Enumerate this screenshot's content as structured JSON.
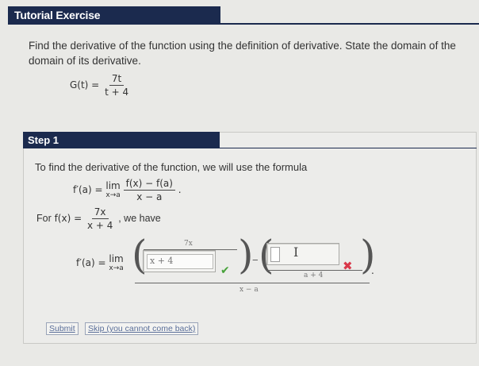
{
  "tutorial": {
    "title": "Tutorial Exercise"
  },
  "problem": {
    "text": "Find the derivative of the function using the definition of derivative. State the domain of the domain of its derivative.",
    "function_lhs": "G(t) =",
    "function_num": "7t",
    "function_den": "t + 4"
  },
  "step": {
    "title": "Step 1",
    "intro": "To find the derivative of the function, we will use the formula",
    "formula_lhs": "f′(a) =",
    "lim_word": "lim",
    "lim_sub": "x→a",
    "formula_num": "f(x) − f(a)",
    "formula_den": "x − a",
    "formula_trail": ".",
    "for_text": "For",
    "for_fx": "f(x) =",
    "for_num": "7x",
    "for_den": "x + 4",
    "we_have": ", we have"
  },
  "answer": {
    "lhs": "f′(a) =",
    "lim_word": "lim",
    "lim_sub": "x→a",
    "box1_top": "7x",
    "box1_input_value": "x + 4",
    "box2_bottom": "a + 4",
    "outer_den": "x − a",
    "minus": "−",
    "trail": "."
  },
  "buttons": {
    "submit": "Submit",
    "skip": "Skip (you cannot come back)"
  },
  "colors": {
    "header_bg": "#1b2a4e",
    "correct": "#47a23a",
    "incorrect": "#d9384a"
  }
}
